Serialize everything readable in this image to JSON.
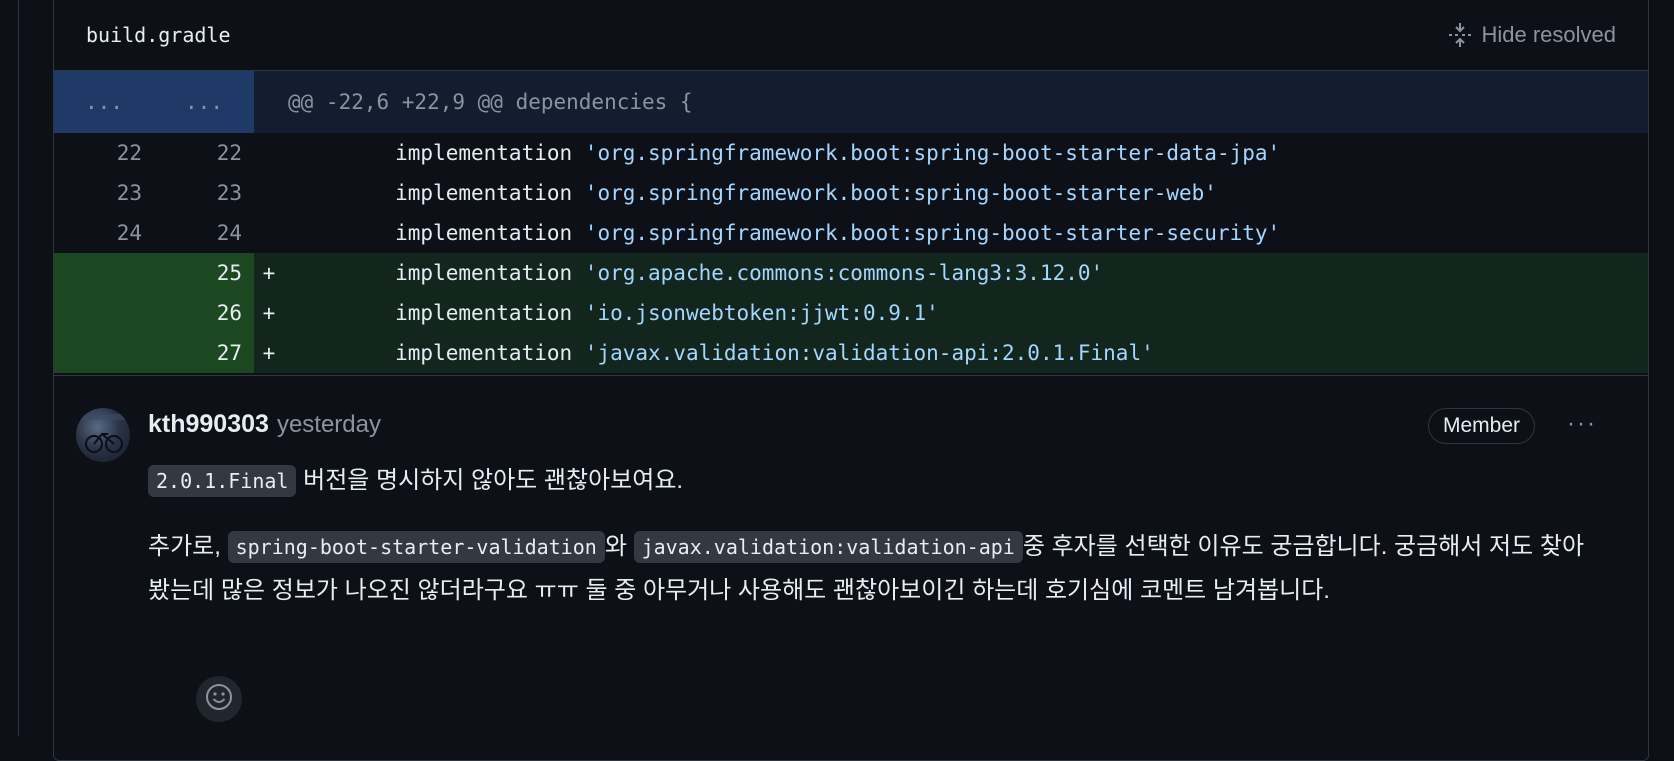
{
  "file": {
    "name": "build.gradle",
    "hide_resolved": "Hide resolved"
  },
  "hunk": {
    "left": "...",
    "right": "...",
    "text": "@@ -22,6 +22,9 @@ dependencies {"
  },
  "lines": [
    {
      "old": "22",
      "new": "22",
      "marker": "",
      "kw": "        implementation ",
      "str": "'org.springframework.boot:spring-boot-starter-data-jpa'",
      "type": "context"
    },
    {
      "old": "23",
      "new": "23",
      "marker": "",
      "kw": "        implementation ",
      "str": "'org.springframework.boot:spring-boot-starter-web'",
      "type": "context"
    },
    {
      "old": "24",
      "new": "24",
      "marker": "",
      "kw": "        implementation ",
      "str": "'org.springframework.boot:spring-boot-starter-security'",
      "type": "context"
    },
    {
      "old": "",
      "new": "25",
      "marker": "+",
      "kw": "        implementation ",
      "str": "'org.apache.commons:commons-lang3:3.12.0'",
      "type": "add"
    },
    {
      "old": "",
      "new": "26",
      "marker": "+",
      "kw": "        implementation ",
      "str": "'io.jsonwebtoken:jjwt:0.9.1'",
      "type": "add"
    },
    {
      "old": "",
      "new": "27",
      "marker": "+",
      "kw": "        implementation ",
      "str": "'javax.validation:validation-api:2.0.1.Final'",
      "type": "add"
    }
  ],
  "comment": {
    "author": "kth990303",
    "time": "yesterday",
    "badge": "Member",
    "more": "···",
    "p1_code": "2.0.1.Final",
    "p1_text": " 버전을 명시하지 않아도 괜찮아보여요.",
    "p2_prefix": "추가로, ",
    "p2_code1": "spring-boot-starter-validation",
    "p2_mid": "와 ",
    "p2_code2": "javax.validation:validation-api",
    "p2_suffix": "중 후자를 선택한 이유도 궁금합니다. 궁금해서 저도 찾아봤는데 많은 정보가 나오진 않더라구요 ㅠㅠ 둘 중 아무거나 사용해도 괜찮아보이긴 하는데 호기심에 코멘트 남겨봅니다."
  },
  "colors": {
    "bg": "#0d1117",
    "hunk_gutter": "#1f3a66",
    "add_row": "#12261e",
    "add_gutter": "#1b4721",
    "string": "#a5d6ff"
  }
}
